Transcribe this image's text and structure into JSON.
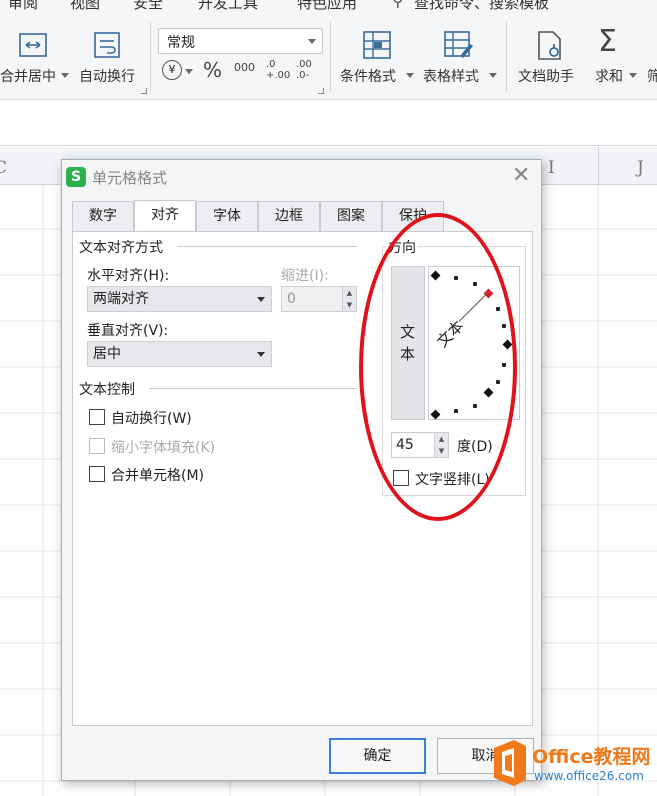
{
  "menu": [
    "审阅",
    "视图",
    "安全",
    "开发工具",
    "特色应用"
  ],
  "search_label": "查找命令、搜索模板",
  "ribbon": {
    "merge_label": "合并居中",
    "wrap_label": "自动换行",
    "format_value": "常规",
    "percent": "%",
    "thousands": "000",
    "inc_decimal": ".0 +.00",
    "dec_decimal": ".00 .0-",
    "cond_format": "条件格式",
    "table_style": "表格样式",
    "doc_helper": "文档助手",
    "sum": "求和",
    "more": "筛"
  },
  "columns": {
    "c": "C",
    "i": "I",
    "j": "J"
  },
  "dialog": {
    "title": "单元格格式",
    "app_badge": "S",
    "tabs": [
      "数字",
      "对齐",
      "字体",
      "边框",
      "图案",
      "保护"
    ],
    "active_tab": "对齐",
    "text_align_section": "文本对齐方式",
    "horizontal_label": "水平对齐(H):",
    "horizontal_value": "两端对齐",
    "indent_label": "缩进(I):",
    "indent_value": "0",
    "vertical_label": "垂直对齐(V):",
    "vertical_value": "居中",
    "text_control_section": "文本控制",
    "wrap_text": "自动换行(W)",
    "shrink_to_fit": "缩小字体填充(K)",
    "merge_cells": "合并单元格(M)",
    "orientation_section": "方向",
    "vertical_text_button": "文本",
    "rotated_text": "文本",
    "degrees_value": "45",
    "degrees_label": "度(D)",
    "vertical_stack": "文字竖排(L)",
    "ok": "确定",
    "cancel": "取消"
  },
  "watermark": {
    "brand": "Office教程网",
    "url": "www.office26.com"
  },
  "colors": {
    "accent": "#3b7fd9",
    "annotation": "#e0131c",
    "watermark_orange": "#f07a1a",
    "watermark_blue": "#2a7fd4"
  }
}
